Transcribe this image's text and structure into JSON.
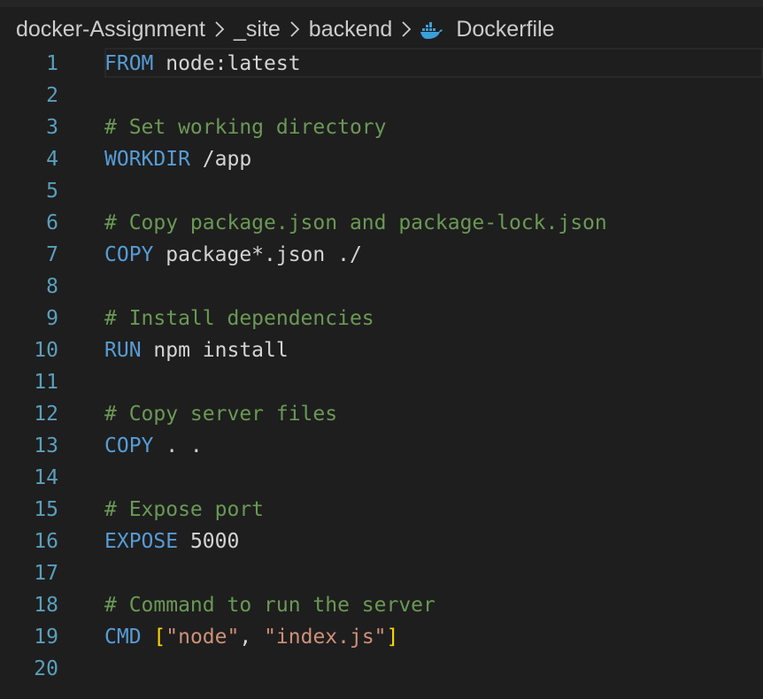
{
  "breadcrumb": {
    "items": [
      "docker-Assignment",
      "_site",
      "backend"
    ],
    "file": "Dockerfile",
    "file_icon": "docker-whale-icon"
  },
  "colors": {
    "background": "#1e1e1e",
    "line_number": "#5a9fbd",
    "keyword": "#569cd6",
    "comment": "#6a9955",
    "string": "#ce9178",
    "bracket": "#ffd700",
    "text": "#d4d4d4"
  },
  "editor": {
    "current_line": 1,
    "lines": [
      {
        "n": "1",
        "tokens": [
          {
            "t": "kw",
            "v": "FROM"
          },
          {
            "t": "tx",
            "v": " node:latest"
          }
        ]
      },
      {
        "n": "2",
        "tokens": []
      },
      {
        "n": "3",
        "tokens": [
          {
            "t": "cm",
            "v": "# Set working directory"
          }
        ]
      },
      {
        "n": "4",
        "tokens": [
          {
            "t": "kw",
            "v": "WORKDIR"
          },
          {
            "t": "tx",
            "v": " /app"
          }
        ]
      },
      {
        "n": "5",
        "tokens": []
      },
      {
        "n": "6",
        "tokens": [
          {
            "t": "cm",
            "v": "# Copy package.json and package-lock.json"
          }
        ]
      },
      {
        "n": "7",
        "tokens": [
          {
            "t": "kw",
            "v": "COPY"
          },
          {
            "t": "tx",
            "v": " package*.json ./"
          }
        ]
      },
      {
        "n": "8",
        "tokens": []
      },
      {
        "n": "9",
        "tokens": [
          {
            "t": "cm",
            "v": "# Install dependencies"
          }
        ]
      },
      {
        "n": "10",
        "tokens": [
          {
            "t": "kw",
            "v": "RUN"
          },
          {
            "t": "tx",
            "v": " npm install"
          }
        ]
      },
      {
        "n": "11",
        "tokens": []
      },
      {
        "n": "12",
        "tokens": [
          {
            "t": "cm",
            "v": "# Copy server files"
          }
        ]
      },
      {
        "n": "13",
        "tokens": [
          {
            "t": "kw",
            "v": "COPY"
          },
          {
            "t": "tx",
            "v": " . ."
          }
        ]
      },
      {
        "n": "14",
        "tokens": []
      },
      {
        "n": "15",
        "tokens": [
          {
            "t": "cm",
            "v": "# Expose port"
          }
        ]
      },
      {
        "n": "16",
        "tokens": [
          {
            "t": "kw",
            "v": "EXPOSE"
          },
          {
            "t": "tx",
            "v": " 5000"
          }
        ]
      },
      {
        "n": "17",
        "tokens": []
      },
      {
        "n": "18",
        "tokens": [
          {
            "t": "cm",
            "v": "# Command to run the server"
          }
        ]
      },
      {
        "n": "19",
        "tokens": [
          {
            "t": "kw",
            "v": "CMD"
          },
          {
            "t": "tx",
            "v": " "
          },
          {
            "t": "br",
            "v": "["
          },
          {
            "t": "str",
            "v": "\"node\""
          },
          {
            "t": "tx",
            "v": ", "
          },
          {
            "t": "str",
            "v": "\"index.js\""
          },
          {
            "t": "br",
            "v": "]"
          }
        ]
      },
      {
        "n": "20",
        "tokens": []
      }
    ]
  }
}
